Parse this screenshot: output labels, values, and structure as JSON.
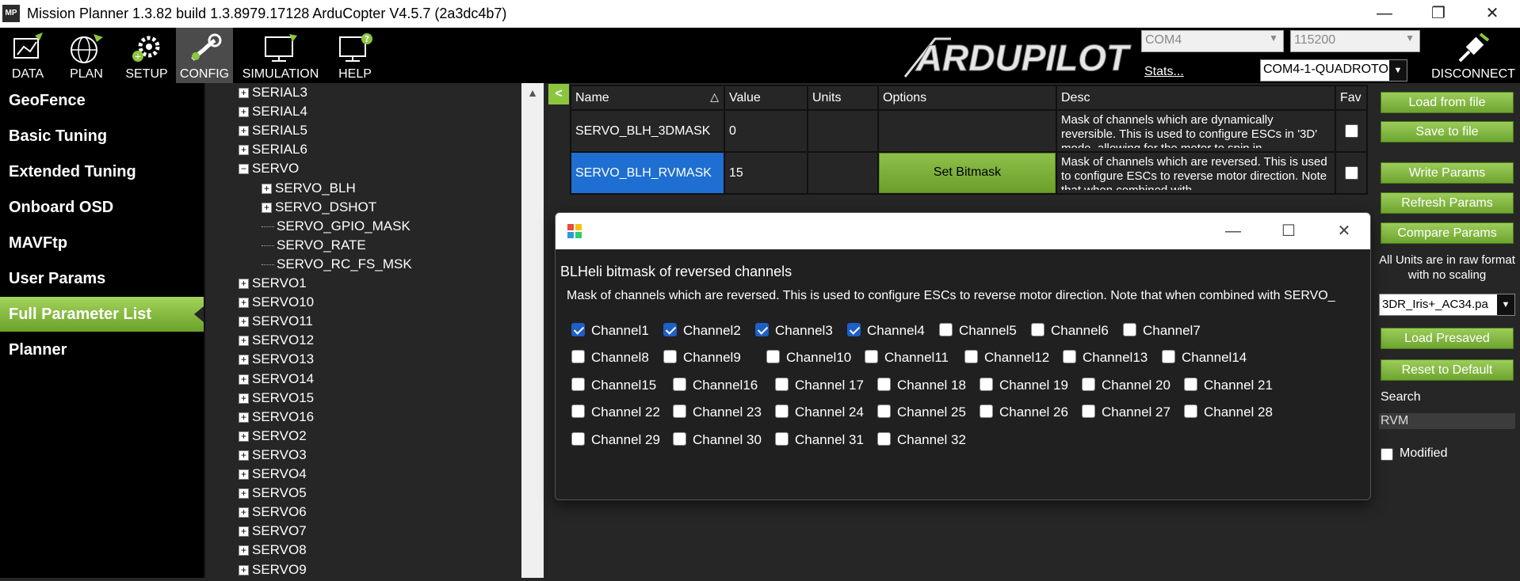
{
  "window": {
    "title": "Mission Planner 1.3.82 build 1.3.8979.17128 ArduCopter V4.5.7 (2a3dc4b7)",
    "app_icon_text": "MP"
  },
  "toolbar": {
    "buttons": [
      {
        "label": "DATA",
        "icon": "data-icon"
      },
      {
        "label": "PLAN",
        "icon": "globe-icon"
      },
      {
        "label": "SETUP",
        "icon": "gears-icon"
      },
      {
        "label": "CONFIG",
        "icon": "wrench-icon",
        "active": true
      },
      {
        "label": "SIMULATION",
        "icon": "monitor-icon"
      },
      {
        "label": "HELP",
        "icon": "help-icon"
      }
    ],
    "logo_text": "ARDUPILOT",
    "port": "COM4",
    "baud": "115200",
    "stats_label": "Stats...",
    "connection": "COM4-1-QUADROTOR",
    "disconnect_label": "DISCONNECT"
  },
  "left_menu": {
    "items": [
      "GeoFence",
      "Basic Tuning",
      "Extended Tuning",
      "Onboard OSD",
      "MAVFtp",
      "User Params",
      "Full Parameter List",
      "Planner"
    ],
    "active": "Full Parameter List"
  },
  "tree": {
    "rows": [
      {
        "label": "SERIAL3",
        "exp": "+"
      },
      {
        "label": "SERIAL4",
        "exp": "+"
      },
      {
        "label": "SERIAL5",
        "exp": "+"
      },
      {
        "label": "SERIAL6",
        "exp": "+"
      },
      {
        "label": "SERVO",
        "exp": "-"
      },
      {
        "label": "SERVO_BLH",
        "exp": "+",
        "child": true
      },
      {
        "label": "SERVO_DSHOT",
        "exp": "+",
        "child": true
      },
      {
        "label": "SERVO_GPIO_MASK",
        "exp": "",
        "child": true
      },
      {
        "label": "SERVO_RATE",
        "exp": "",
        "child": true
      },
      {
        "label": "SERVO_RC_FS_MSK",
        "exp": "",
        "child": true
      },
      {
        "label": "SERVO1",
        "exp": "+"
      },
      {
        "label": "SERVO10",
        "exp": "+"
      },
      {
        "label": "SERVO11",
        "exp": "+"
      },
      {
        "label": "SERVO12",
        "exp": "+"
      },
      {
        "label": "SERVO13",
        "exp": "+"
      },
      {
        "label": "SERVO14",
        "exp": "+"
      },
      {
        "label": "SERVO15",
        "exp": "+"
      },
      {
        "label": "SERVO16",
        "exp": "+"
      },
      {
        "label": "SERVO2",
        "exp": "+"
      },
      {
        "label": "SERVO3",
        "exp": "+"
      },
      {
        "label": "SERVO4",
        "exp": "+"
      },
      {
        "label": "SERVO5",
        "exp": "+"
      },
      {
        "label": "SERVO6",
        "exp": "+"
      },
      {
        "label": "SERVO7",
        "exp": "+"
      },
      {
        "label": "SERVO8",
        "exp": "+"
      },
      {
        "label": "SERVO9",
        "exp": "+"
      }
    ]
  },
  "grid": {
    "collapse_label": "<",
    "headers": {
      "name": "Name",
      "value": "Value",
      "units": "Units",
      "options": "Options",
      "desc": "Desc",
      "fav": "Fav"
    },
    "sort_indicator": "△",
    "rows": [
      {
        "name": "SERVO_BLH_3DMASK",
        "value": "0",
        "units": "",
        "options": "",
        "desc": "Mask of channels which are dynamically reversible. This is used to configure ESCs in '3D' mode, allowing for the motor to spin in"
      },
      {
        "name": "SERVO_BLH_RVMASK",
        "value": "15",
        "units": "",
        "options": "Set Bitmask",
        "desc": "Mask of channels which are reversed. This is used to configure ESCs to reverse motor direction. Note that when combined with"
      }
    ]
  },
  "right_panel": {
    "load_from_file": "Load from file",
    "save_to_file": "Save to file",
    "write_params": "Write Params",
    "refresh_params": "Refresh Params",
    "compare_params": "Compare Params",
    "note": "All Units are in raw format with no scaling",
    "preset": "3DR_Iris+_AC34.pa",
    "load_presaved": "Load Presaved",
    "reset_default": "Reset to Default",
    "search_label": "Search",
    "search_value": "RVM",
    "modified_label": "Modified"
  },
  "dialog": {
    "heading": "BLHeli bitmask of reversed channels",
    "description": "Mask of channels which are reversed. This is used to configure ESCs to reverse motor direction. Note that when combined with SERVO_",
    "channels": [
      {
        "label": "Channel1",
        "checked": true
      },
      {
        "label": "Channel2",
        "checked": true
      },
      {
        "label": "Channel3",
        "checked": true
      },
      {
        "label": "Channel4",
        "checked": true
      },
      {
        "label": "Channel5",
        "checked": false
      },
      {
        "label": "Channel6",
        "checked": false
      },
      {
        "label": "Channel7",
        "checked": false
      },
      {
        "label": "Channel8",
        "checked": false
      },
      {
        "label": "Channel9",
        "checked": false
      },
      {
        "label": "Channel10",
        "checked": false
      },
      {
        "label": "Channel11",
        "checked": false
      },
      {
        "label": "Channel12",
        "checked": false
      },
      {
        "label": "Channel13",
        "checked": false
      },
      {
        "label": "Channel14",
        "checked": false
      },
      {
        "label": "Channel15",
        "checked": false
      },
      {
        "label": "Channel16",
        "checked": false
      },
      {
        "label": "Channel 17",
        "checked": false
      },
      {
        "label": "Channel 18",
        "checked": false
      },
      {
        "label": "Channel 19",
        "checked": false
      },
      {
        "label": "Channel 20",
        "checked": false
      },
      {
        "label": "Channel 21",
        "checked": false
      },
      {
        "label": "Channel 22",
        "checked": false
      },
      {
        "label": "Channel 23",
        "checked": false
      },
      {
        "label": "Channel 24",
        "checked": false
      },
      {
        "label": "Channel 25",
        "checked": false
      },
      {
        "label": "Channel 26",
        "checked": false
      },
      {
        "label": "Channel 27",
        "checked": false
      },
      {
        "label": "Channel 28",
        "checked": false
      },
      {
        "label": "Channel 29",
        "checked": false
      },
      {
        "label": "Channel 30",
        "checked": false
      },
      {
        "label": "Channel 31",
        "checked": false
      },
      {
        "label": "Channel 32",
        "checked": false
      }
    ]
  },
  "colors": {
    "accent_green": "#8cc63f",
    "selection_blue": "#1e6fd1",
    "background": "#262626"
  }
}
